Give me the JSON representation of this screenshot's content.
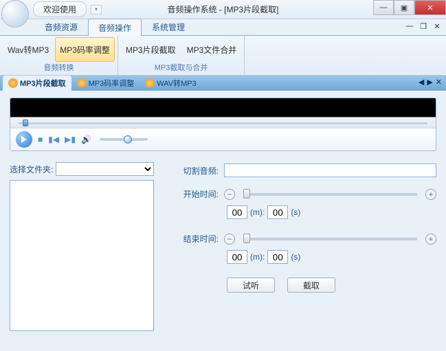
{
  "title": {
    "welcome": "欢迎使用",
    "app": "音频操作系统 - [MP3片段截取]"
  },
  "menu": {
    "items": [
      "音频资源",
      "音频操作",
      "系统管理"
    ],
    "active": 1
  },
  "menubar_ctrls": {
    "min": "—",
    "restore": "❐",
    "close": "✕"
  },
  "ribbon": {
    "group1": {
      "label": "音频转换",
      "btns": [
        "Wav转MP3",
        "MP3码率调整"
      ]
    },
    "group2": {
      "label": "MP3截取与合并",
      "btns": [
        "MP3片段截取",
        "MP3文件合并"
      ]
    }
  },
  "subtabs": {
    "items": [
      "MP3片段截取",
      "MP3码率调整",
      "WAV转MP3"
    ],
    "active": 0,
    "nav": [
      "◀",
      "▶",
      "✕"
    ]
  },
  "form": {
    "folder_label": "选择文件夹:",
    "cut_label": "切割音频:",
    "start_label": "开始时间:",
    "end_label": "结束时间:",
    "m_unit": "(m):",
    "s_unit": "(s)",
    "start_m": "00",
    "start_s": "00",
    "end_m": "00",
    "end_s": "00",
    "preview_btn": "试听",
    "cut_btn": "截取"
  },
  "win": {
    "min": "—",
    "max": "▣",
    "close": "✕"
  }
}
